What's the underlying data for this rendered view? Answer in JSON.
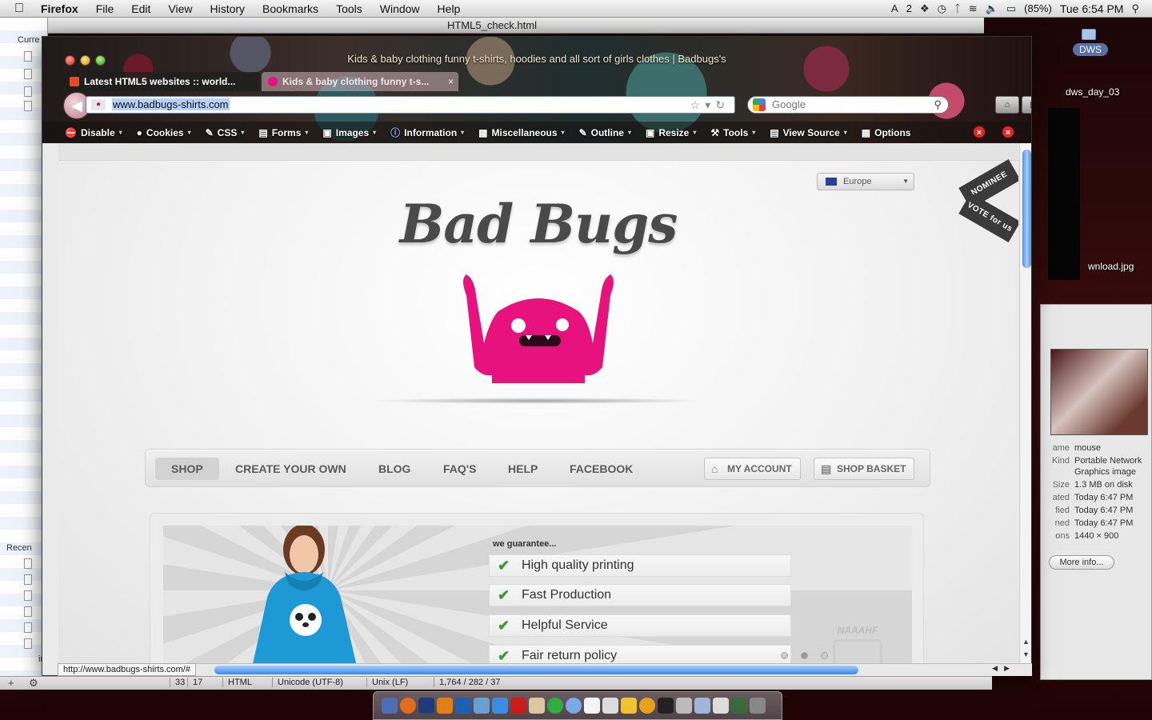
{
  "menubar": {
    "app": "Firefox",
    "items": [
      "File",
      "Edit",
      "View",
      "History",
      "Bookmarks",
      "Tools",
      "Window",
      "Help"
    ],
    "input_indicator": "2",
    "battery": "(85%)",
    "clock": "Tue 6:54 PM"
  },
  "editor": {
    "title": "HTML5_check.html",
    "sidebar_current": "Curre",
    "sidebar_recent": "Recen",
    "sidebar_last": "inde",
    "status": {
      "line": "33",
      "col": "17",
      "language": "HTML",
      "encoding": "Unicode (UTF-8)",
      "line_endings": "Unix (LF)",
      "counts": "1,764 / 282 / 37"
    }
  },
  "desktop": {
    "folder_label": "DWS",
    "file1": "dws_day_03",
    "file2": "wnload.jpg"
  },
  "info_panel": {
    "rows": [
      {
        "k": "ame",
        "v": "mouse"
      },
      {
        "k": "Kind",
        "v": "Portable Network"
      },
      {
        "k": "",
        "v": "Graphics image"
      },
      {
        "k": "Size",
        "v": "1.3 MB on disk"
      },
      {
        "k": "ated",
        "v": "Today 6:47 PM"
      },
      {
        "k": "fied",
        "v": "Today 6:47 PM"
      },
      {
        "k": "ned",
        "v": "Today 6:47 PM"
      },
      {
        "k": "ons",
        "v": "1440 × 900"
      }
    ],
    "more_button": "More info..."
  },
  "firefox": {
    "window_title": "Kids & baby clothing funny t-shirts, hoodies and all sort of girls clothes | Badbugs's",
    "tabs": [
      {
        "label": "Latest HTML5 websites :: world...",
        "active": false
      },
      {
        "label": "Kids & baby clothing funny t-s...",
        "active": true
      }
    ],
    "url": "www.badbugs-shirts.com",
    "search_placeholder": "Google",
    "devbar": [
      "Disable",
      "Cookies",
      "CSS",
      "Forms",
      "Images",
      "Information",
      "Miscellaneous",
      "Outline",
      "Resize",
      "Tools",
      "View Source",
      "Options"
    ],
    "status_url": "http://www.badbugs-shirts.com/#"
  },
  "page": {
    "region": "Europe",
    "nominee_top": "NOMINEE",
    "nominee_bottom": "VOTE for us",
    "logo_text": "Bad Bugs",
    "nav": [
      "SHOP",
      "CREATE YOUR OWN",
      "BLOG",
      "FAQ'S",
      "HELP",
      "FACEBOOK"
    ],
    "nav_active": "SHOP",
    "my_account": "MY ACCOUNT",
    "shop_basket": "SHOP BASKET",
    "guarantee_header": "we guarantee...",
    "guarantees": [
      "High quality printing",
      "Fast Production",
      "Helpful Service",
      "Fair return policy"
    ],
    "robot_label": "NAAAHF"
  },
  "colors": {
    "brand_pink": "#e8127e",
    "check_green": "#3a9b3a",
    "selection_blue": "#b5d1f7"
  }
}
